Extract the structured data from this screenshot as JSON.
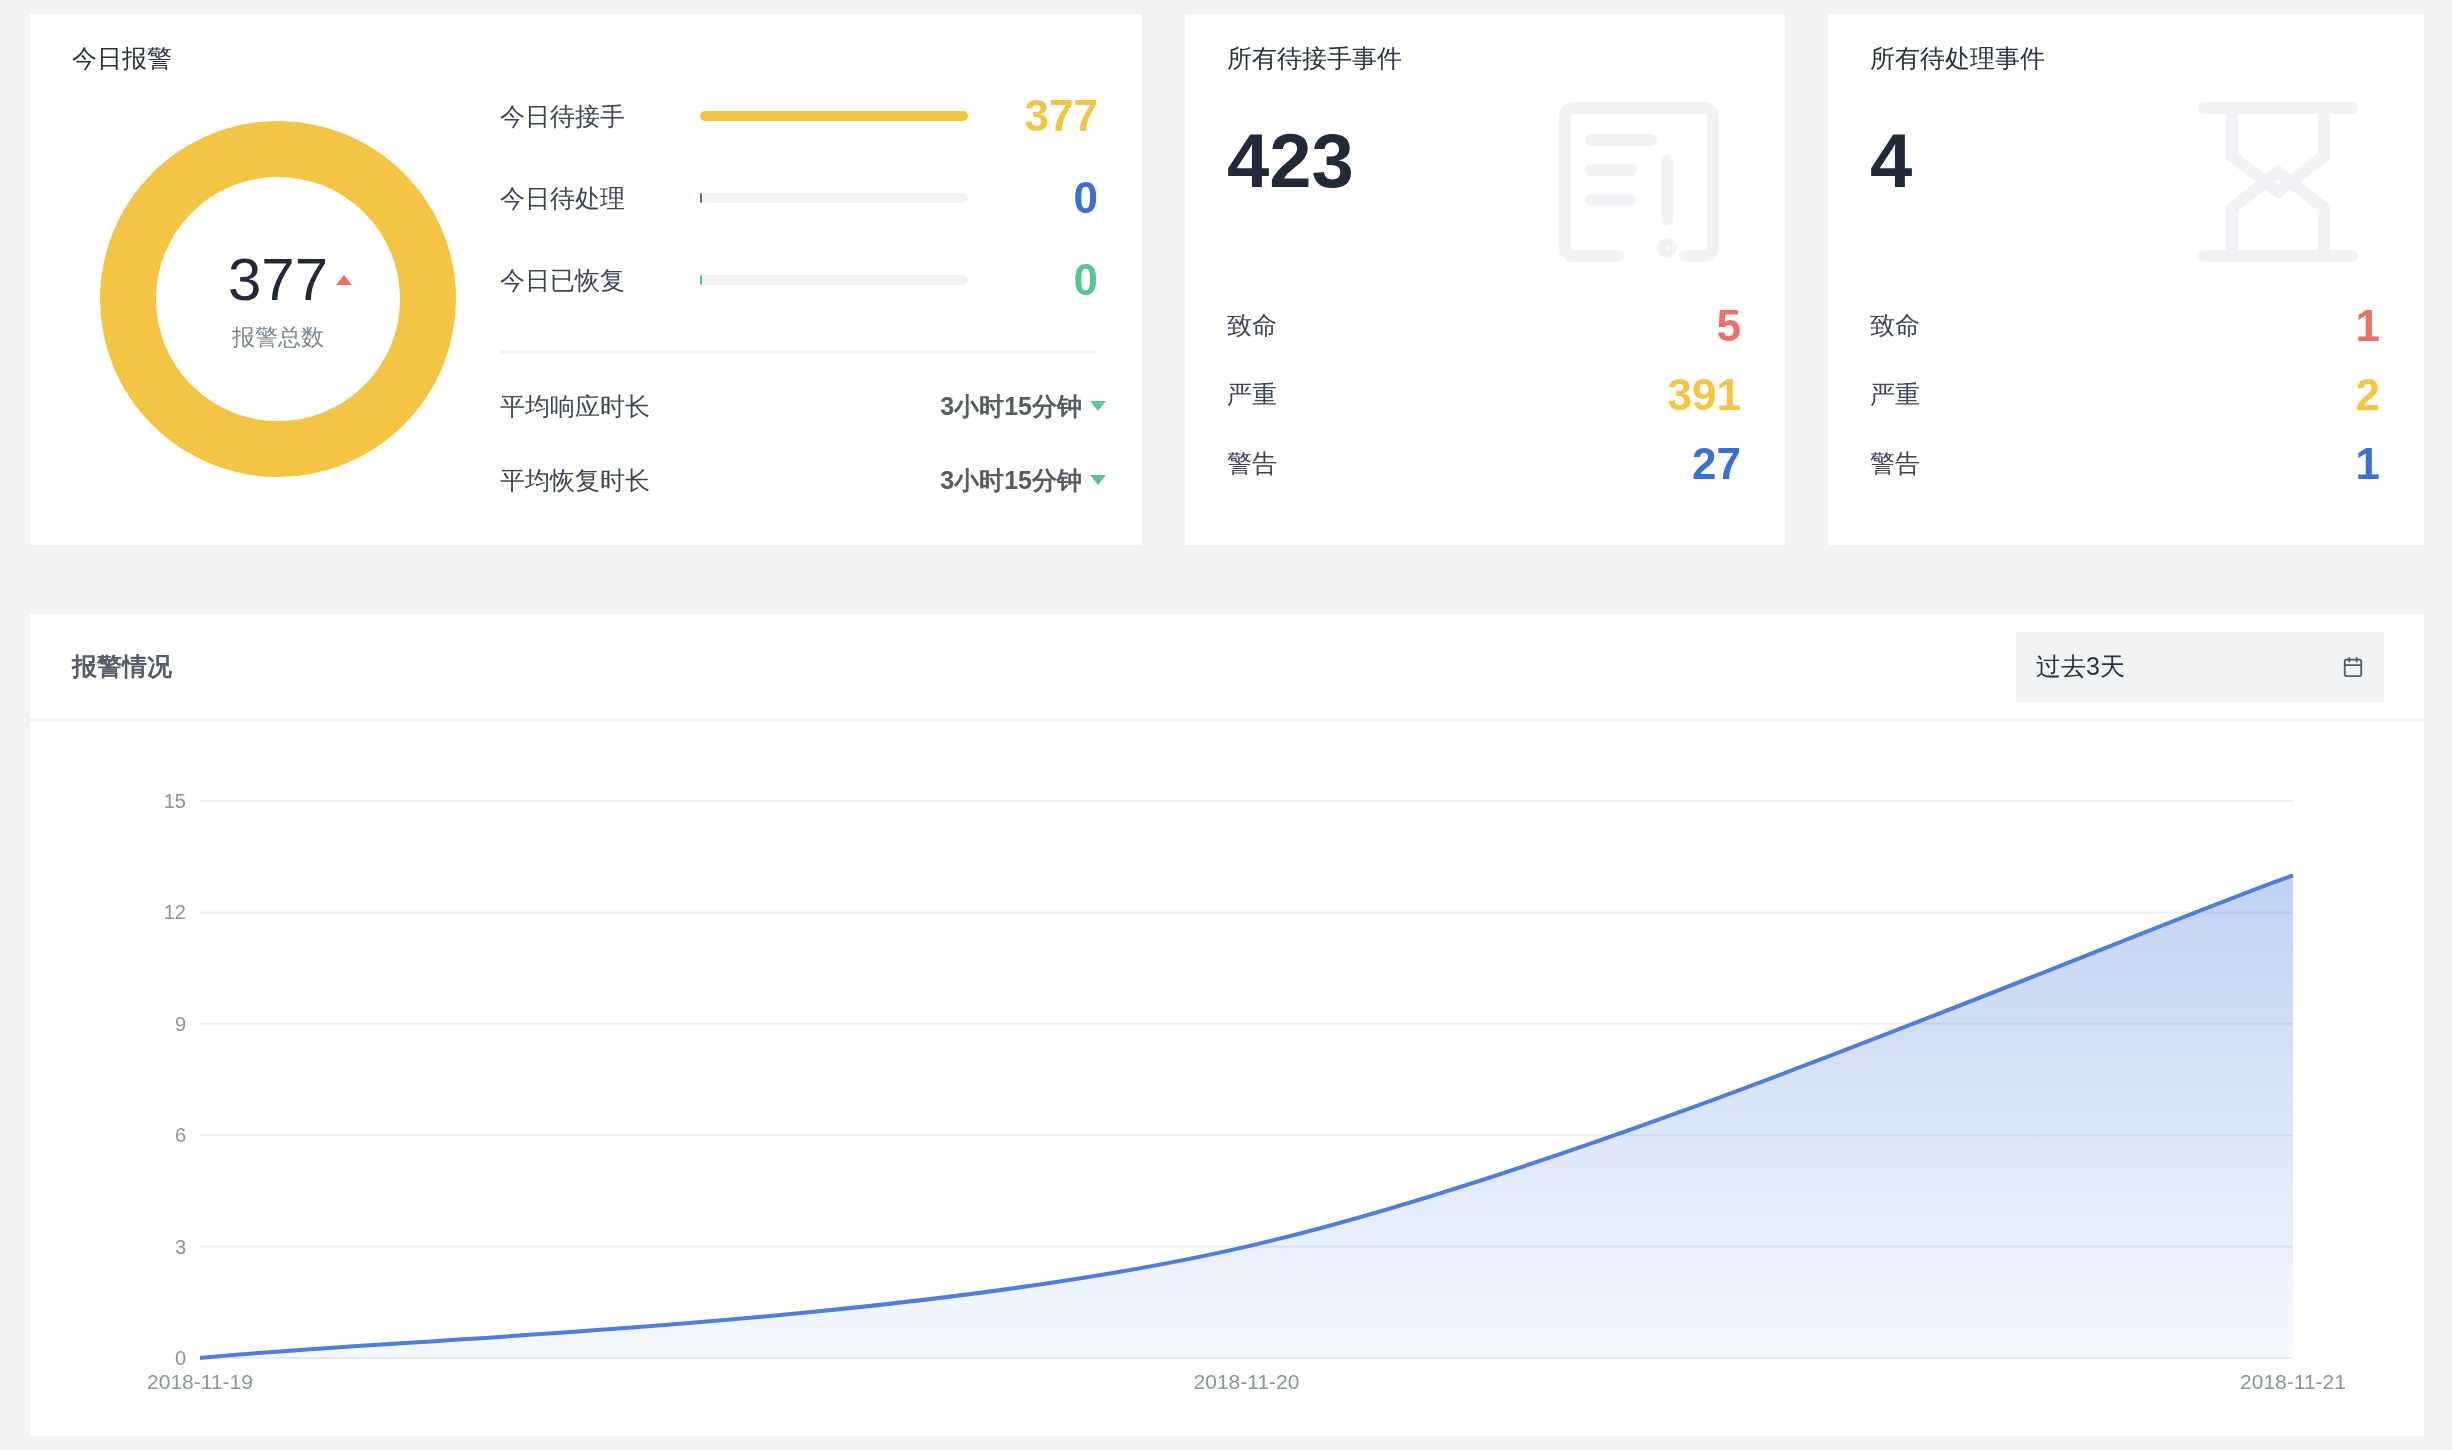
{
  "today": {
    "title": "今日报警",
    "total": "377",
    "total_label": "报警总数",
    "rising": true,
    "bars": [
      {
        "label": "今日待接手",
        "level": 1,
        "value": "377",
        "color": "#f4c545"
      },
      {
        "label": "今日待处理",
        "level": 0,
        "value": "0",
        "color": "#3a6fd8"
      },
      {
        "label": "今日已恢复",
        "level": 0,
        "value": "0",
        "color": "#5ac493"
      }
    ],
    "durations": [
      {
        "label": "平均响应时长",
        "value": "3小时15分钟",
        "rising": false
      },
      {
        "label": "平均恢复时长",
        "value": "3小时15分钟",
        "rising": false
      }
    ]
  },
  "cards": [
    {
      "title": "所有待接手事件",
      "count": "423",
      "kind": "document",
      "rows": [
        {
          "label": "致命",
          "value": "5",
          "color": "#ef6f67"
        },
        {
          "label": "严重",
          "value": "391",
          "color": "#f4c545"
        },
        {
          "label": "警告",
          "value": "27",
          "color": "#3a6fd8"
        }
      ]
    },
    {
      "title": "所有待处理事件",
      "count": "4",
      "kind": "hourglass",
      "rows": [
        {
          "label": "致命",
          "value": "1",
          "color": "#ef6f67"
        },
        {
          "label": "严重",
          "value": "2",
          "color": "#f4c545"
        },
        {
          "label": "警告",
          "value": "1",
          "color": "#3a6fd8"
        }
      ]
    }
  ],
  "chart_panel": {
    "title": "报警情况",
    "range": {
      "value": "过去3天"
    },
    "chart_data": {
      "type": "area",
      "categories": [
        "2018-11-19",
        "2018-11-20",
        "2018-11-21"
      ],
      "series": [
        {
          "color": "#4e7ddb",
          "values": [
            0,
            3,
            13
          ]
        }
      ],
      "grid": true,
      "ylim": [
        0,
        15
      ],
      "yticks": [
        0,
        3,
        6,
        9,
        12,
        15
      ]
    }
  }
}
